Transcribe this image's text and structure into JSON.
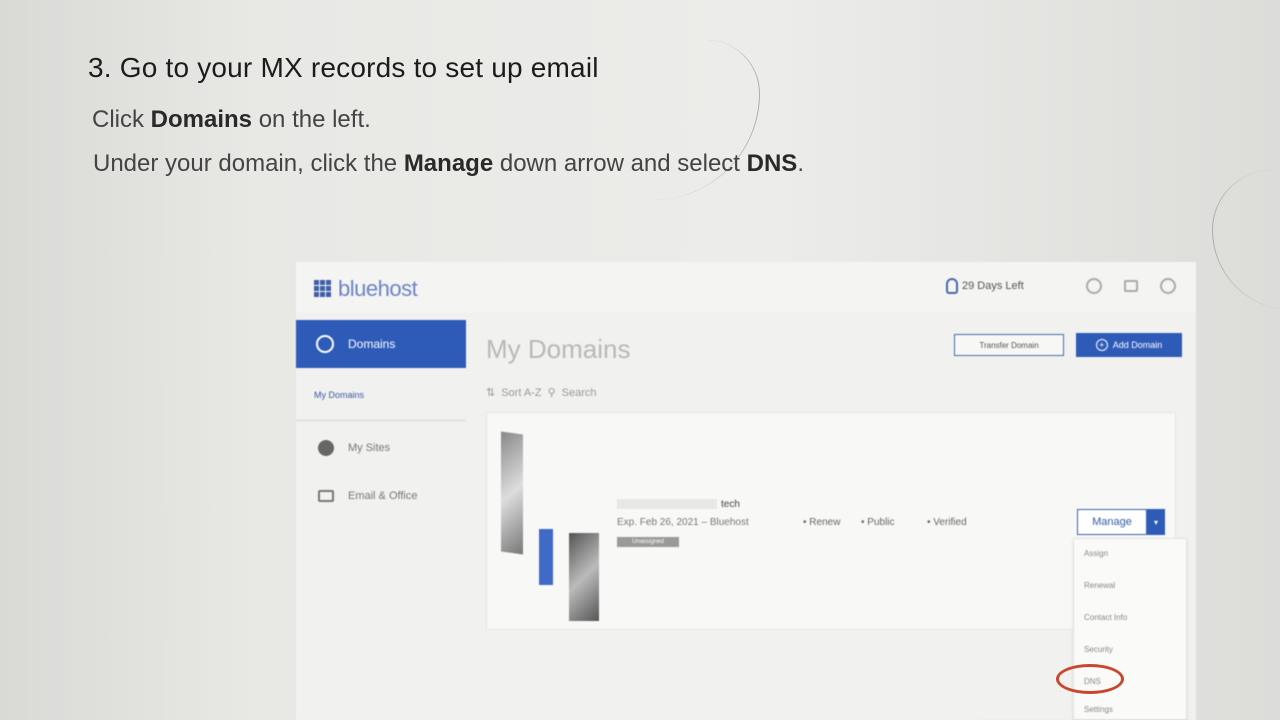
{
  "doc": {
    "heading": "3. Go to your MX records to set up email",
    "line1_pre": "Click ",
    "line1_bold": "Domains",
    "line1_post": " on the left.",
    "line2_pre": "Under your domain, click the ",
    "line2_bold1": "Manage",
    "line2_mid": " down arrow and select ",
    "line2_bold2": "DNS",
    "line2_post": "."
  },
  "bluehost": {
    "logo_text": "bluehost",
    "trial_text": "29 Days Left",
    "top_icons": [
      "help-icon",
      "cart-icon",
      "account-icon"
    ],
    "sidebar": {
      "active_label": "Domains",
      "sub_label": "My Domains",
      "items": [
        {
          "label": "My Sites",
          "icon": "wordpress-icon"
        },
        {
          "label": "Email & Office",
          "icon": "mail-icon"
        }
      ]
    },
    "main": {
      "title": "My Domains",
      "transfer_button": "Transfer Domain",
      "add_button": "Add Domain",
      "sort_label": "Sort A-Z",
      "search_label": "Search",
      "domain": {
        "name_suffix": "tech",
        "expiry": "Exp. Feb 26, 2021 – Bluehost",
        "renew": "Renew",
        "privacy": "Public",
        "status": "Verified",
        "badge": "Unassigned"
      },
      "manage_label": "Manage",
      "manage_arrow": "▾",
      "dropdown": [
        "Assign",
        "Renewal",
        "Contact Info",
        "Security",
        "DNS",
        "Settings"
      ]
    }
  },
  "colors": {
    "brand_blue": "#2e5bb8",
    "highlight_circle": "#c9472e"
  }
}
